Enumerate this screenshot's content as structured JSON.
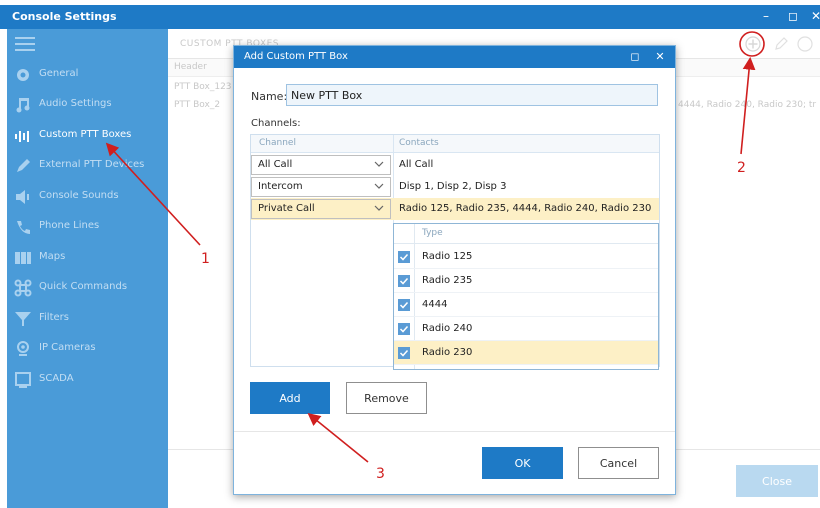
{
  "window": {
    "title": "Console Settings",
    "controls": [
      "minimize-icon",
      "maximize-icon",
      "close-icon"
    ]
  },
  "sidebar": {
    "items": [
      {
        "label": "General",
        "icon": "gear-icon"
      },
      {
        "label": "Audio Settings",
        "icon": "music-note-icon"
      },
      {
        "label": "Custom PTT Boxes",
        "icon": "equalizer-icon"
      },
      {
        "label": "External PTT Devices",
        "icon": "pen-icon"
      },
      {
        "label": "Console Sounds",
        "icon": "speaker-icon"
      },
      {
        "label": "Phone Lines",
        "icon": "phone-icon"
      },
      {
        "label": "Maps",
        "icon": "map-icon"
      },
      {
        "label": "Quick Commands",
        "icon": "command-icon"
      },
      {
        "label": "Filters",
        "icon": "filter-icon"
      },
      {
        "label": "IP Cameras",
        "icon": "camera-icon"
      },
      {
        "label": "SCADA",
        "icon": "monitor-icon"
      }
    ],
    "active_index": 2
  },
  "main": {
    "section_title": "CUSTOM PTT BOXES",
    "grid_header": "Header",
    "rows": [
      {
        "name": "PTT Box_123",
        "contacts": ""
      },
      {
        "name": "PTT Box_2",
        "contacts": "4444, Radio 240, Radio 230; tr"
      }
    ],
    "close_label": "Close"
  },
  "dialog": {
    "title": "Add Custom PTT Box",
    "name_label": "Name:",
    "name_value": "New PTT Box",
    "channels_label": "Channels:",
    "col_channel": "Channel",
    "col_contacts": "Contacts",
    "channels": [
      {
        "channel": "All Call",
        "contacts": "All Call",
        "selected": false
      },
      {
        "channel": "Intercom",
        "contacts": "Disp 1, Disp 2, Disp 3",
        "selected": false
      },
      {
        "channel": "Private Call",
        "contacts": "Radio 125, Radio 235, 4444, Radio 240, Radio 230",
        "selected": true
      }
    ],
    "contacts_header": "Type",
    "contacts_list": [
      {
        "name": "Radio 125",
        "checked": true
      },
      {
        "name": "Radio 235",
        "checked": true
      },
      {
        "name": "4444",
        "checked": true
      },
      {
        "name": "Radio 240",
        "checked": true
      },
      {
        "name": "Radio 230",
        "checked": true
      }
    ],
    "add_label": "Add",
    "remove_label": "Remove",
    "ok_label": "OK",
    "cancel_label": "Cancel"
  },
  "annotations": {
    "labels": [
      "1",
      "2",
      "3"
    ],
    "color": "#d01f1f"
  },
  "colors": {
    "accent": "#1e7ac6",
    "sidebar": "#4a9bd8",
    "selection": "#fdf0c6"
  }
}
